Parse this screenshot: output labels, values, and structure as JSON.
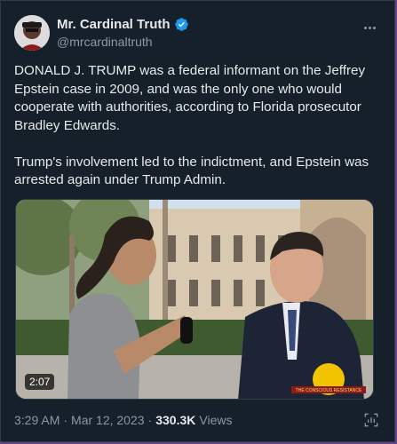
{
  "author": {
    "name": "Mr. Cardinal Truth",
    "handle": "@mrcardinaltruth",
    "verified": true
  },
  "tweet": {
    "paragraph1": "DONALD J. TRUMP was a federal informant on the Jeffrey Epstein case in 2009, and was the only one who would cooperate with authorities, according to Florida prosecutor Bradley Edwards.",
    "paragraph2": "Trump's involvement led to the indictment, and Epstein was arrested again under Trump Admin."
  },
  "media": {
    "duration": "2:07",
    "watermark_text": "THE CONSCIOUS RESISTANCE"
  },
  "meta": {
    "time": "3:29 AM",
    "separator": "·",
    "date": "Mar 12, 2023",
    "views_count": "330.3K",
    "views_label": "Views"
  },
  "icons": {
    "more": "more-horizontal-icon",
    "verified": "verified-badge-icon",
    "analytics": "analytics-icon"
  },
  "colors": {
    "background": "#15202b",
    "text": "#e7e9ea",
    "secondary": "#8b98a5",
    "verified_blue": "#1d9bf0",
    "outer_frame": "#6a3f8f"
  }
}
